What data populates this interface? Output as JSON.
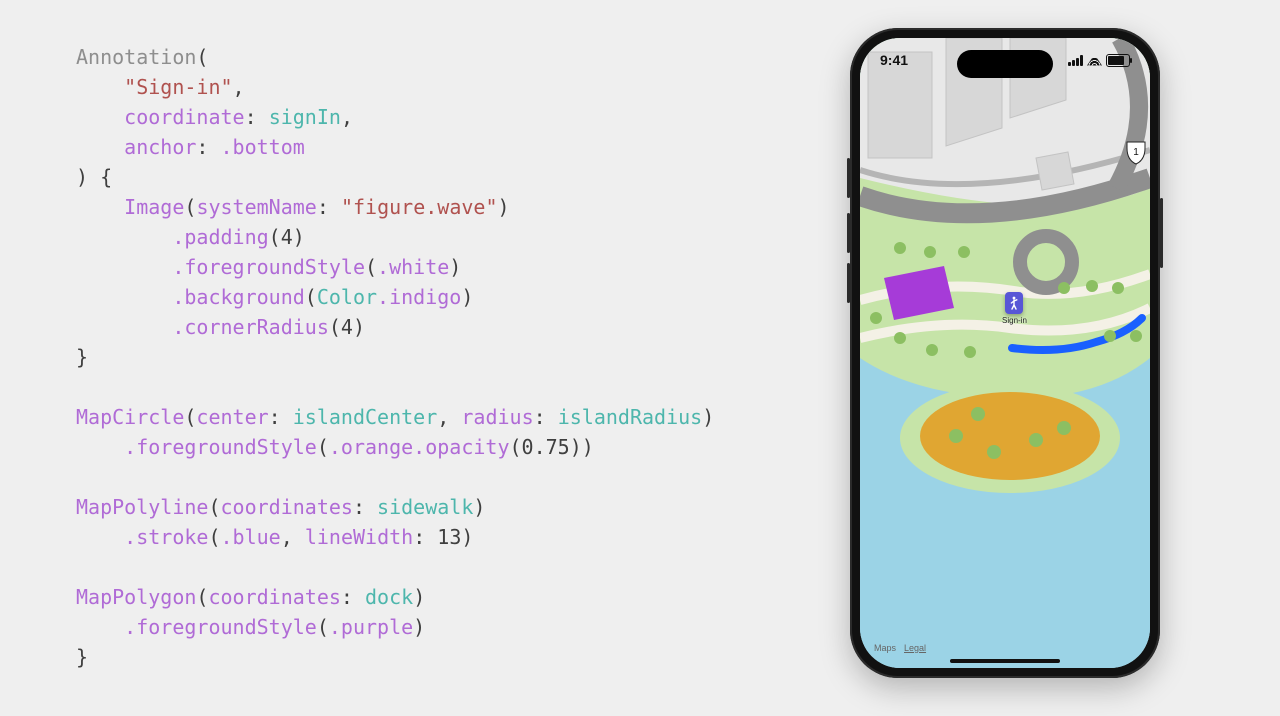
{
  "code": {
    "annotation_fn": "Annotation",
    "sign_in_str": "\"Sign-in\"",
    "coordinate_lbl": "coordinate",
    "coordinate_val": "signIn",
    "anchor_lbl": "anchor",
    "anchor_val": ".bottom",
    "image_fn": "Image",
    "systemName_lbl": "systemName",
    "systemName_val": "\"figure.wave\"",
    "padding_fn": ".padding",
    "padding_arg": "4",
    "fgstyle_fn": ".foregroundStyle",
    "white_val": ".white",
    "background_fn": ".background",
    "color_type": "Color",
    "indigo_prop": ".indigo",
    "corner_fn": ".cornerRadius",
    "corner_arg": "4",
    "mapcircle_fn": "MapCircle",
    "center_lbl": "center",
    "center_val": "islandCenter",
    "radius_lbl": "radius",
    "radius_val": "islandRadius",
    "orange_val": ".orange",
    "opacity_fn": ".opacity",
    "opacity_arg": "0.75",
    "mappolyline_fn": "MapPolyline",
    "coordinates_lbl": "coordinates",
    "sidewalk_val": "sidewalk",
    "stroke_fn": ".stroke",
    "blue_val": ".blue",
    "linewidth_lbl": "lineWidth",
    "linewidth_val": "13",
    "mappolygon_fn": "MapPolygon",
    "dock_val": "dock",
    "purple_val": ".purple"
  },
  "phone": {
    "time": "9:41",
    "annotation_label": "Sign-in",
    "maps_logo": "Maps",
    "legal": "Legal",
    "route_shield": "1"
  },
  "colors": {
    "indigo": "#5856d6",
    "orange75": "rgba(255,149,0,0.75)",
    "blue": "#0a84ff",
    "purple": "#af52de"
  }
}
